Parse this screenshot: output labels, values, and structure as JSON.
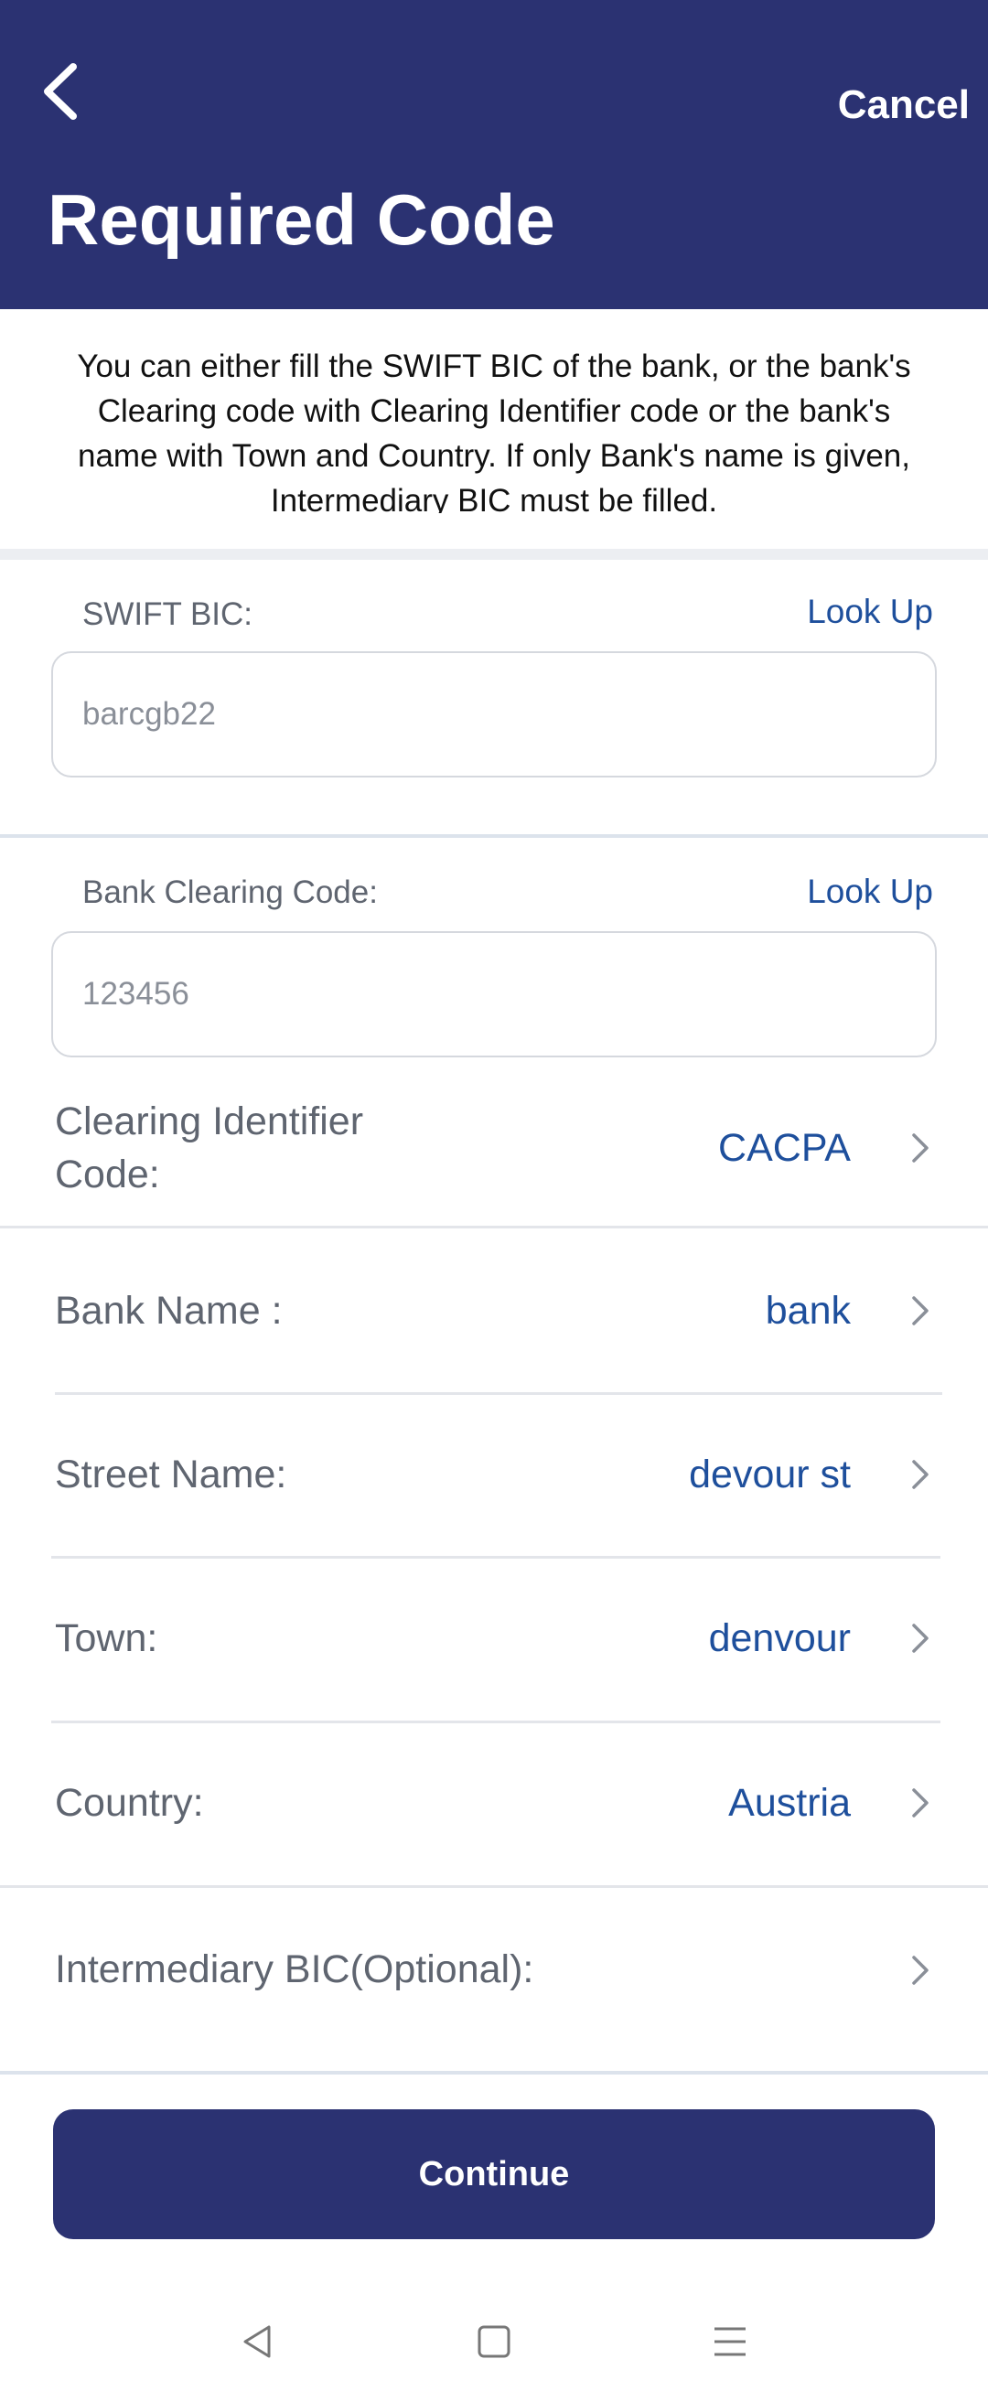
{
  "header": {
    "title": "Required Code",
    "cancel_label": "Cancel",
    "back_icon": "chevron-left-icon",
    "bg_color": "#2b3272"
  },
  "intro_text": "You can either fill the SWIFT BIC of the bank, or the bank's Clearing code with Clearing Identifier code or the bank's name with Town and Country. If only Bank's name is given, Intermediary BIC must be filled.",
  "swift": {
    "label": "SWIFT BIC:",
    "lookup_label": "Look Up",
    "placeholder": "barcgb22"
  },
  "clearing": {
    "label": "Bank Clearing Code:",
    "lookup_label": "Look Up",
    "placeholder": "123456"
  },
  "rows": [
    {
      "label_line1": "Clearing Identifier",
      "label_line2": "Code:",
      "value": "CACPA"
    },
    {
      "label": "Bank Name :",
      "value": "bank"
    },
    {
      "label": "Street Name:",
      "value": "devour st"
    },
    {
      "label": "Town:",
      "value": "denvour"
    },
    {
      "label": "Country:",
      "value": "Austria"
    },
    {
      "label": "Intermediary BIC(Optional):",
      "value": ""
    }
  ],
  "continue_label": "Continue",
  "colors": {
    "primary": "#2b3272",
    "link": "#1e4f9c",
    "label": "#5f6570"
  },
  "nav": {
    "back_icon": "triangle-back-icon",
    "home_icon": "square-home-icon",
    "menu_icon": "menu-lines-icon"
  }
}
